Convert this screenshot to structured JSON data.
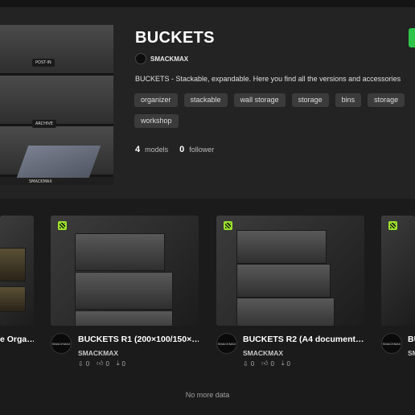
{
  "collection": {
    "title": "BUCKETS",
    "author": "SMACKMAX",
    "description": "BUCKETS - Stackable, expandable. Here you find all the versions and accessories",
    "tags": [
      "organizer",
      "stackable",
      "wall storage",
      "storage",
      "bins",
      "storage",
      "workshop"
    ],
    "models_count": "4",
    "models_label": "models",
    "followers_count": "0",
    "followers_label": "follower",
    "cover_labels": [
      "POST-IN",
      "ARCHIVE",
      "SMACKMAX"
    ],
    "accent_color": "#2ec44a"
  },
  "avatar_text": "SMACKMAX",
  "cards": [
    {
      "title": "e Orga…",
      "author": "",
      "downloads": "",
      "likes": "",
      "collects": ""
    },
    {
      "title": "BUCKETS R1 (200×100/150×…",
      "author": "SMACKMAX",
      "downloads": "0",
      "likes": "0",
      "collects": "0"
    },
    {
      "title": "BUCKETS R2 (A4 document…",
      "author": "SMACKMAX",
      "downloads": "0",
      "likes": "0",
      "collects": "0"
    },
    {
      "title": "BU",
      "author": "SM",
      "downloads": "",
      "likes": "",
      "collects": ""
    }
  ],
  "footer": {
    "no_more": "No more data"
  },
  "icons": {
    "download": "download-icon",
    "like": "thumbs-up-icon",
    "collect": "collect-icon"
  }
}
